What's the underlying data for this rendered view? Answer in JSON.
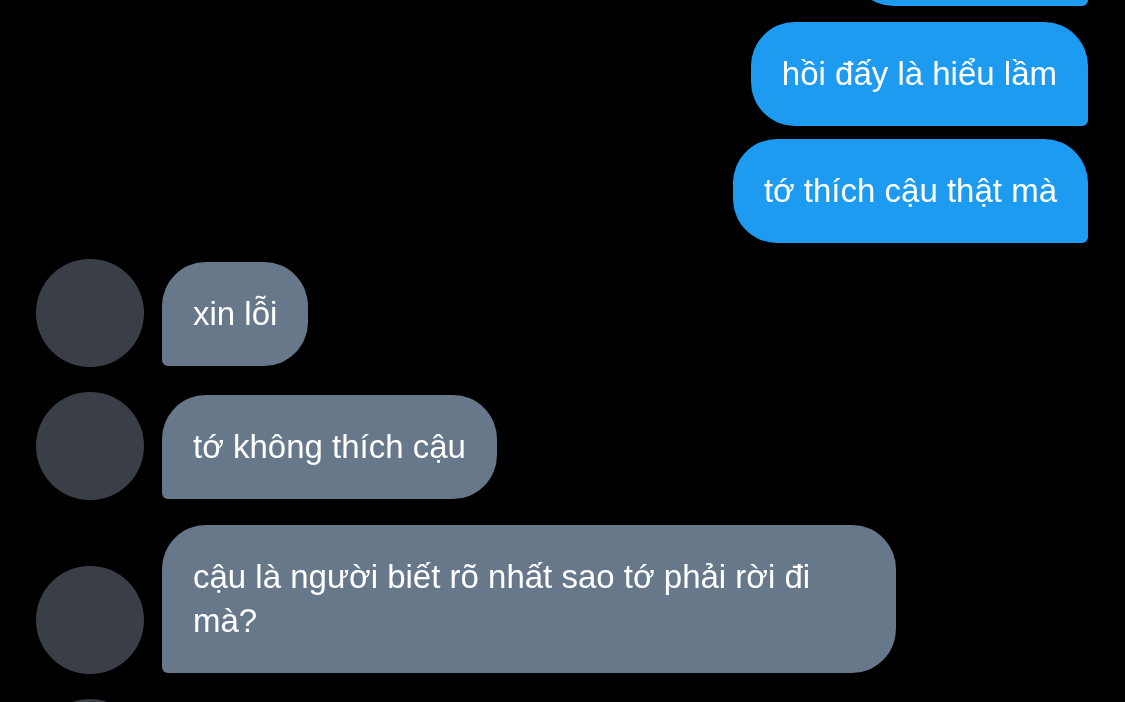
{
  "messages": [
    {
      "kind": "outgoing-partial"
    },
    {
      "kind": "outgoing",
      "text": "hồi đấy là hiểu lầm"
    },
    {
      "kind": "outgoing",
      "text": "tớ thích cậu thật mà"
    },
    {
      "kind": "incoming",
      "text": "xin lỗi"
    },
    {
      "kind": "incoming",
      "text": "tớ không thích cậu"
    },
    {
      "kind": "incoming",
      "text": "cậu là người biết rõ nhất sao tớ phải rời đi mà?"
    },
    {
      "kind": "incoming-partial"
    }
  ]
}
